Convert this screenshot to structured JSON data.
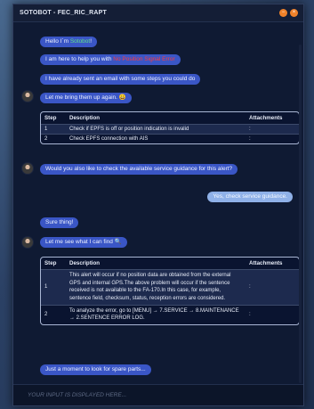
{
  "window": {
    "title": "SOTOBOT - FEC_RIC_RAPT",
    "btn_min": "−",
    "btn_close": "×"
  },
  "messages": {
    "m1_prefix": "Hello I`m ",
    "m1_name": "Sotobot",
    "m1_suffix": "!",
    "m2_prefix": "I am here to help you with ",
    "m2_highlight": "No Position Signal Error",
    "m3": "I have already sent an email with some steps you could do",
    "m4": "Let me bring them up again. 😀",
    "m5": "Would you also like to check the available service guidance for this alert?",
    "u1": "Yes, check service guidance.",
    "m6": "Sure thing!",
    "m7": "Let me see what I can find 🔍",
    "m8": "Just a moment to look for spare parts..."
  },
  "table1": {
    "headers": {
      "step": "Step",
      "description": "Description",
      "attachments": "Attachments"
    },
    "rows": [
      {
        "step": "1",
        "description": "Check if EPFS is off or position indication is invalid",
        "attachments": ":"
      },
      {
        "step": "2",
        "description": "Check EPFS connection with AIS",
        "attachments": ":"
      }
    ]
  },
  "table2": {
    "headers": {
      "step": "Step",
      "description": "Description",
      "attachments": "Attachments"
    },
    "rows": [
      {
        "step": "1",
        "description": "This alert will occur if no position data are obtained from the external GPS and internal GPS.The above problem will occur if the sentence received is not available to the FA-170.In this case, for example, sentence field, checksum, status, reception errors are considered.",
        "attachments": ":"
      },
      {
        "step": "2",
        "description": "To analyze the error, go to [MENU] → 7.SERVICE → 8.MAINTENANCE → 2.SENTENCE ERROR LOG.",
        "attachments": ":"
      }
    ]
  },
  "input": {
    "placeholder": "YOUR INPUT IS DISPLAYED HERE..."
  }
}
